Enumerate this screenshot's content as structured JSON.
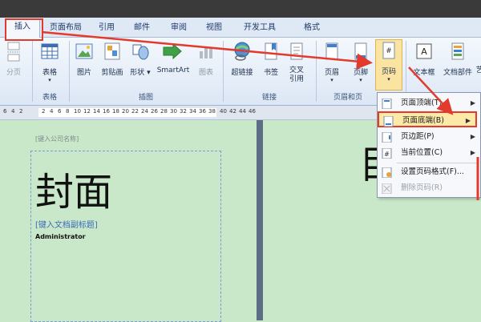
{
  "tabs": [
    {
      "label": "插入",
      "active": true
    },
    {
      "label": "页面布局"
    },
    {
      "label": "引用"
    },
    {
      "label": "邮件"
    },
    {
      "label": "审阅"
    },
    {
      "label": "视图"
    },
    {
      "label": "开发工具"
    },
    {
      "label": "格式"
    }
  ],
  "ribbon": {
    "fenye": "分页",
    "biaoge": "表格",
    "tupian": "图片",
    "jiantiehua": "剪贴画",
    "xingzhuang": "形状",
    "smartart": "SmartArt",
    "tubiao": "图表",
    "chaolianjie": "超链接",
    "shuqian": "书签",
    "jiaochayinyong": "交叉\n引用",
    "yemei": "页眉",
    "yejiao": "页脚",
    "yema": "页码",
    "wenbenkuang": "文本框",
    "wendangbujian": "文档部件",
    "more": "艺"
  },
  "groups": {
    "biaoge": "表格",
    "chatu": "插图",
    "lianjie": "链接",
    "yemeiheyejiao": "页眉和页"
  },
  "ruler_numbers": [
    "6",
    "4",
    "2",
    "2",
    "4",
    "6",
    "8",
    "10",
    "12",
    "14",
    "16",
    "18",
    "20",
    "22",
    "24",
    "26",
    "28",
    "30",
    "32",
    "34",
    "36",
    "38",
    "40",
    "42",
    "44",
    "46"
  ],
  "document": {
    "company_field": "[键入公司名称]",
    "cover_title": "封面",
    "subtitle_field": "[键入文档副标题]",
    "author": "Administrator",
    "next_page_char": "目"
  },
  "menu": {
    "items": [
      {
        "label": "页面顶端(T)",
        "submenu": true
      },
      {
        "label": "页面底端(B)",
        "submenu": true,
        "highlighted": true
      },
      {
        "label": "页边距(P)",
        "submenu": true
      },
      {
        "label": "当前位置(C)",
        "submenu": true
      },
      {
        "label": "设置页码格式(F)..."
      },
      {
        "label": "删除页码(R)",
        "disabled": true
      }
    ]
  },
  "colors": {
    "annotation_red": "#e23b2e",
    "highlight": "#fde9a8",
    "page_bg": "#c9e8c9"
  },
  "icons": [
    "page-break-icon",
    "table-icon",
    "picture-icon",
    "clipart-icon",
    "shapes-icon",
    "smartart-icon",
    "chart-icon",
    "hyperlink-icon",
    "bookmark-icon",
    "cross-reference-icon",
    "header-icon",
    "footer-icon",
    "page-number-icon",
    "textbox-icon",
    "quick-parts-icon",
    "submenu-arrow-icon"
  ]
}
